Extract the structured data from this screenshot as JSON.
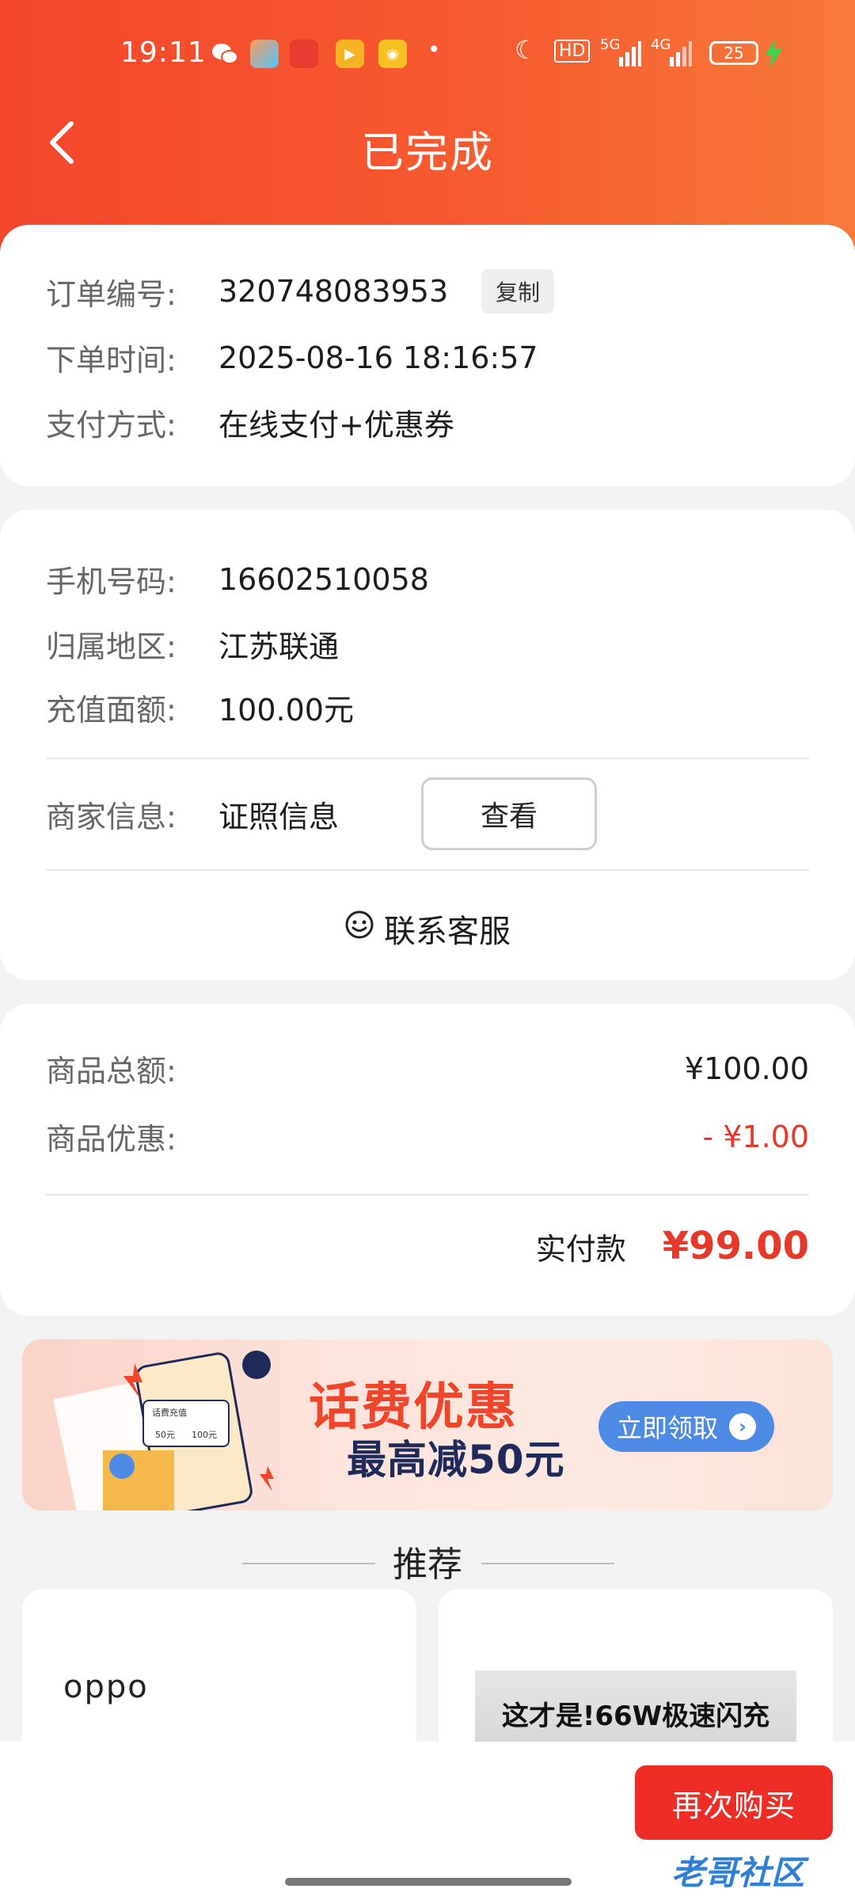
{
  "status_bar": {
    "time": "19:11",
    "battery": "25",
    "network_labels": [
      "HD",
      "5G",
      "4G"
    ]
  },
  "header": {
    "title": "已完成"
  },
  "order": {
    "number_label": "订单编号:",
    "number": "320748083953",
    "copy_label": "复制",
    "time_label": "下单时间:",
    "time": "2025-08-16 18:16:57",
    "payment_label": "支付方式:",
    "payment": "在线支付+优惠券"
  },
  "recharge": {
    "phone_label": "手机号码:",
    "phone": "16602510058",
    "region_label": "归属地区:",
    "region": "江苏联通",
    "amount_label": "充值面额:",
    "amount": "100.00元",
    "merchant_label": "商家信息:",
    "merchant_value": "证照信息",
    "view_label": "查看",
    "contact_label": "联系客服"
  },
  "summary": {
    "total_label": "商品总额:",
    "total": "¥100.00",
    "discount_label": "商品优惠:",
    "discount": "- ¥1.00",
    "paid_label": "实付款",
    "paid": "¥99.00"
  },
  "banner": {
    "title": "话费优惠",
    "subtitle": "最高减50元",
    "claim_label": "立即领取",
    "card_small_labels": [
      "话费充值",
      "50元",
      "100元"
    ]
  },
  "recommend": {
    "title": "推荐",
    "products": [
      {
        "brand": "oppo"
      },
      {
        "caption": "这才是!66W极速闪充"
      }
    ]
  },
  "bottom": {
    "buy_again_label": "再次购买",
    "watermark": "老哥社区"
  },
  "colors": {
    "header_start": "#f3462c",
    "header_end": "#f77a3b",
    "accent_red": "#e8382a",
    "buy_button": "#ee2e26",
    "claim_button": "#4d8be6"
  }
}
